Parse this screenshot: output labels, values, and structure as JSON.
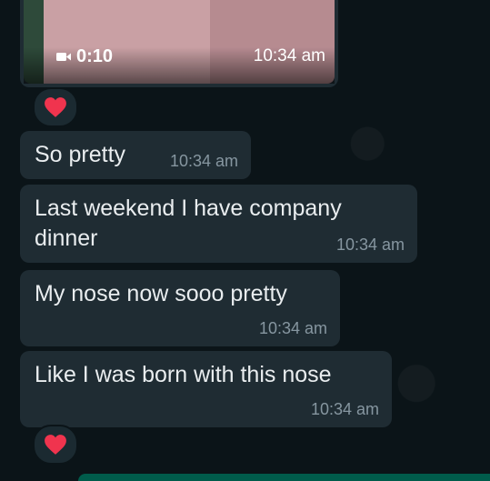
{
  "video_message": {
    "duration": "0:10",
    "time": "10:34 am",
    "camera_icon": "video-camera-icon"
  },
  "reactions": [
    {
      "emoji": "heart-icon",
      "color": "#f0344e"
    },
    {
      "emoji": "heart-icon",
      "color": "#f0344e"
    }
  ],
  "messages": [
    {
      "text": "So pretty",
      "time": "10:34 am"
    },
    {
      "text": "Last weekend I have company dinner",
      "time": "10:34 am"
    },
    {
      "text": "My nose now sooo pretty",
      "time": "10:34 am"
    },
    {
      "text": "Like I was born with this nose",
      "time": "10:34 am"
    }
  ],
  "colors": {
    "background": "#0b1418",
    "incoming_bubble": "#1f2c33",
    "timestamp": "#8696a0",
    "outgoing_bubble": "#005c4b"
  }
}
